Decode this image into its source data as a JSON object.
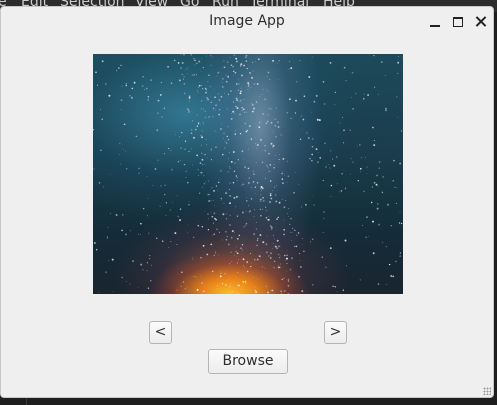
{
  "background_menu": {
    "items": [
      "e",
      "Edit",
      "Selection",
      "View",
      "Go",
      "Run",
      "Terminal",
      "Help"
    ]
  },
  "window": {
    "title": "Image App",
    "controls": {
      "minimize_icon": "minimize-icon",
      "maximize_icon": "maximize-icon",
      "close_icon": "close-icon"
    }
  },
  "image": {
    "subject": "starry-night-sky-milky-way",
    "colors": {
      "sky": "#1a3d4d",
      "glow": "#ffb428"
    }
  },
  "nav": {
    "prev_label": "<",
    "next_label": ">"
  },
  "browse_label": "Browse"
}
